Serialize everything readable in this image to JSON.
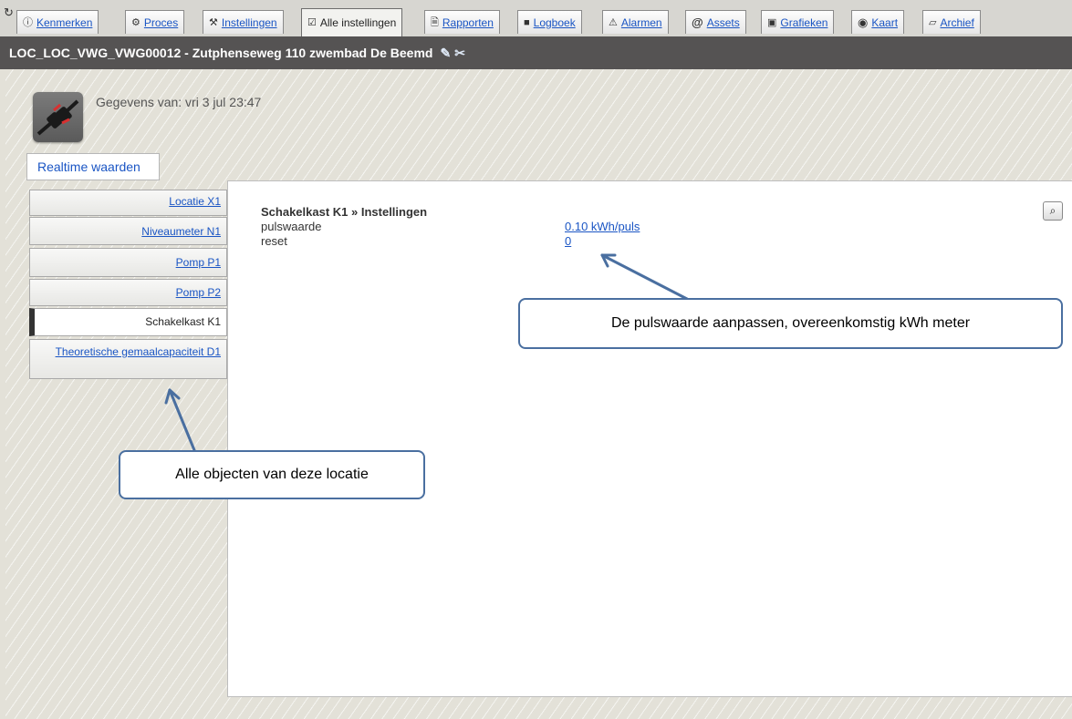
{
  "toolbar": {
    "refresh_icon": "refresh-icon"
  },
  "tabs": [
    {
      "label": "Kenmerken",
      "icon": "info-icon",
      "active": false
    },
    {
      "label": "Proces",
      "icon": "gear-icon",
      "active": false
    },
    {
      "label": "Instellingen",
      "icon": "wrench-icon",
      "active": false
    },
    {
      "label": "Alle instellingen",
      "icon": "settings-list-icon",
      "active": true
    },
    {
      "label": "Rapporten",
      "icon": "report-icon",
      "active": false
    },
    {
      "label": "Logboek",
      "icon": "book-icon",
      "active": false
    },
    {
      "label": "Alarmen",
      "icon": "alarm-icon",
      "active": false
    },
    {
      "label": "Assets",
      "icon": "at-icon",
      "active": false
    },
    {
      "label": "Grafieken",
      "icon": "image-icon",
      "active": false
    },
    {
      "label": "Kaart",
      "icon": "globe-icon",
      "active": false
    },
    {
      "label": "Archief",
      "icon": "folder-icon",
      "active": false
    }
  ],
  "header": {
    "title": "LOC_LOC_VWG_VWG00012 - Zutphenseweg 110 zwembad De Beemd"
  },
  "info": {
    "data_label": "Gegevens van: vri 3 jul 23:47"
  },
  "realtime_button": "Realtime waarden",
  "sidebar": {
    "items": [
      {
        "label": "Locatie X1",
        "selected": false
      },
      {
        "label": "Niveaumeter N1",
        "selected": false
      },
      {
        "label": "Pomp P1",
        "selected": false
      },
      {
        "label": "Pomp P2",
        "selected": false
      },
      {
        "label": "Schakelkast K1",
        "selected": true
      },
      {
        "label": "Theoretische gemaalcapaciteit D1",
        "selected": false
      }
    ]
  },
  "panel": {
    "title": "Schakelkast K1 » Instellingen",
    "rows": [
      {
        "label": "pulswaarde",
        "value": "0.10 kWh/puls"
      },
      {
        "label": "reset",
        "value": "0"
      }
    ]
  },
  "callouts": {
    "right": "De pulswaarde aanpassen, overeenkomstig kWh meter",
    "left": "Alle objecten van deze locatie"
  },
  "colors": {
    "link": "#1a55c4",
    "titlebar": "#555353",
    "callout_border": "#4a6fa0"
  }
}
